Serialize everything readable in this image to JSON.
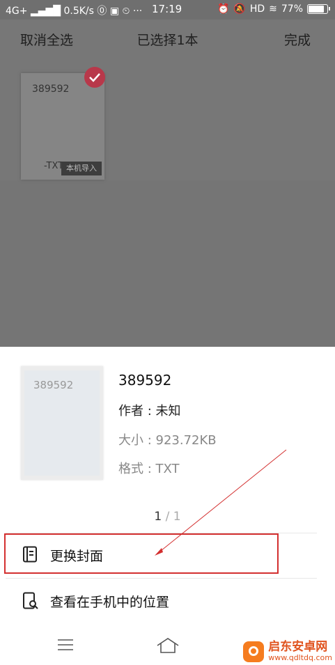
{
  "status_bar": {
    "network": "4G+",
    "speed": "0.5K/s",
    "time": "17:19",
    "hd": "HD",
    "battery": "77%",
    "battery_level": 0.77
  },
  "top_bar": {
    "cancel_all": "取消全选",
    "title": "已选择1本",
    "done": "完成"
  },
  "shelf": {
    "book_number": "389592",
    "book_ext": "-TXT",
    "tag": "本机导入"
  },
  "sheet": {
    "cover_number": "389592",
    "title": "389592",
    "author": "作者 : 未知",
    "size": "大小 : 923.72KB",
    "format": "格式 : TXT",
    "page_current": "1",
    "page_sep": " / ",
    "page_total": "1",
    "actions": [
      {
        "label": "更换封面",
        "icon": "book-cover-icon"
      },
      {
        "label": "查看在手机中的位置",
        "icon": "phone-search-icon"
      }
    ]
  },
  "navbar": {
    "menu_icon": "menu-icon",
    "home_icon": "home-icon"
  },
  "watermark": {
    "name": "启东安卓网",
    "url": "www.qdltdq.com"
  },
  "colors": {
    "accent_red": "#d32f2f",
    "check_red": "#b8384a",
    "watermark": "#e0531e"
  }
}
